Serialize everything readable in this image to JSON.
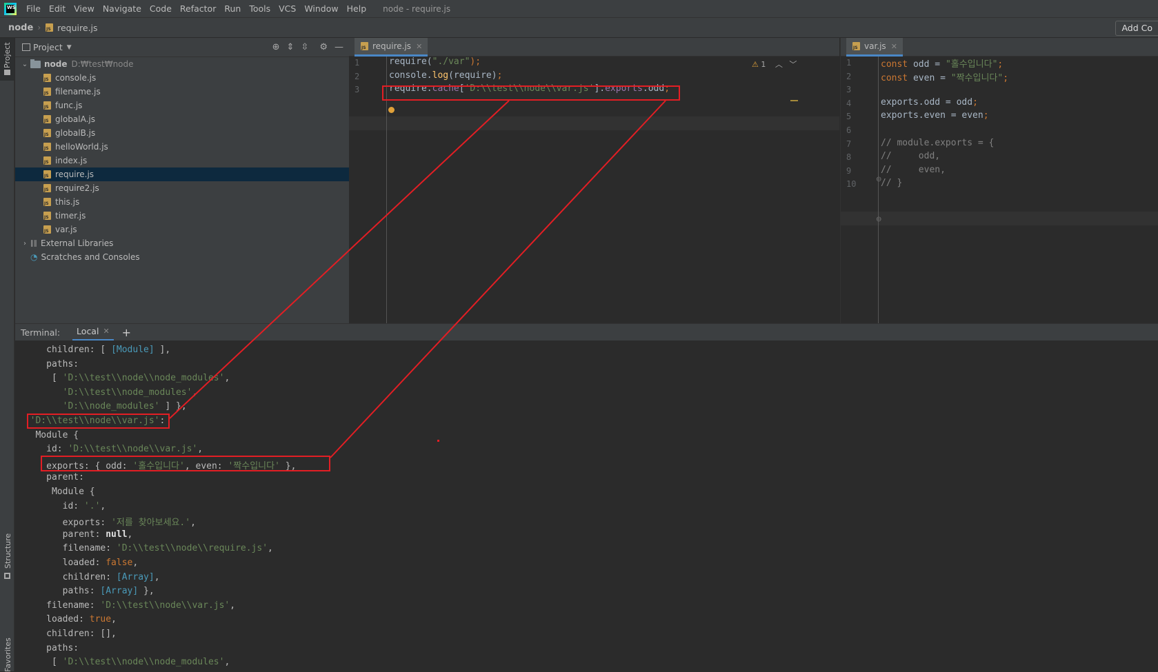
{
  "app": {
    "logo_text": "WS",
    "window_title": "node - require.js"
  },
  "menu": [
    "File",
    "Edit",
    "View",
    "Navigate",
    "Code",
    "Refactor",
    "Run",
    "Tools",
    "VCS",
    "Window",
    "Help"
  ],
  "nav": {
    "project": "node",
    "file": "require.js",
    "add_config": "Add Co"
  },
  "side_tabs": {
    "project": "Project",
    "structure": "Structure",
    "favorites": "Favorites"
  },
  "project_panel": {
    "title": "Project",
    "root": {
      "name": "node",
      "path": "D:₩test₩node"
    },
    "files": [
      "console.js",
      "filename.js",
      "func.js",
      "globalA.js",
      "globalB.js",
      "helloWorld.js",
      "index.js",
      "require.js",
      "require2.js",
      "this.js",
      "timer.js",
      "var.js"
    ],
    "selected": "require.js",
    "external": "External Libraries",
    "scratches": "Scratches and Consoles"
  },
  "editor_left": {
    "tab": "require.js",
    "line_numbers": [
      "1",
      "2",
      "3"
    ],
    "warning_count": "1",
    "lines": [
      [
        {
          "t": "require(",
          "c": ""
        },
        {
          "t": "\"./var\"",
          "c": "str"
        },
        {
          "t": ");",
          "c": "kw"
        }
      ],
      [
        {
          "t": "console.",
          "c": ""
        },
        {
          "t": "log",
          "c": "fn"
        },
        {
          "t": "(require)",
          "c": ""
        },
        {
          "t": ";",
          "c": "kw"
        }
      ],
      [
        {
          "t": "require.",
          "c": ""
        },
        {
          "t": "cache",
          "c": "prop"
        },
        {
          "t": "[",
          "c": ""
        },
        {
          "t": "'D:\\\\test\\\\node\\\\var.js'",
          "c": "str"
        },
        {
          "t": "].",
          "c": ""
        },
        {
          "t": "exports",
          "c": "prop"
        },
        {
          "t": ".odd",
          "c": ""
        },
        {
          "t": ";",
          "c": "kw"
        }
      ]
    ]
  },
  "editor_right": {
    "tab": "var.js",
    "line_numbers": [
      "1",
      "2",
      "3",
      "4",
      "5",
      "6",
      "7",
      "8",
      "9",
      "10"
    ],
    "lines": [
      [
        {
          "t": "const ",
          "c": "kw"
        },
        {
          "t": "odd = ",
          "c": ""
        },
        {
          "t": "\"홀수입니다\"",
          "c": "str"
        },
        {
          "t": ";",
          "c": "kw"
        }
      ],
      [
        {
          "t": "const ",
          "c": "kw"
        },
        {
          "t": "even = ",
          "c": ""
        },
        {
          "t": "\"짝수입니다\"",
          "c": "str"
        },
        {
          "t": ";",
          "c": "kw"
        }
      ],
      [],
      [
        {
          "t": "exports.odd = odd",
          "c": ""
        },
        {
          "t": ";",
          "c": "kw"
        }
      ],
      [
        {
          "t": "exports.even = even",
          "c": ""
        },
        {
          "t": ";",
          "c": "kw"
        }
      ],
      [],
      [
        {
          "t": "// module.exports = {",
          "c": "cmt"
        }
      ],
      [
        {
          "t": "//     odd,",
          "c": "cmt"
        }
      ],
      [
        {
          "t": "//     even,",
          "c": "cmt"
        }
      ],
      [
        {
          "t": "// }",
          "c": "cmt"
        }
      ]
    ]
  },
  "terminal": {
    "label": "Terminal:",
    "tab": "Local",
    "add": "+",
    "lines": [
      [
        {
          "t": "     children: [ ",
          "c": ""
        },
        {
          "t": "[Module]",
          "c": "tb"
        },
        {
          "t": " ],",
          "c": ""
        }
      ],
      [
        {
          "t": "     paths:",
          "c": ""
        }
      ],
      [
        {
          "t": "      [ ",
          "c": ""
        },
        {
          "t": "'D:\\\\test\\\\node\\\\node_modules'",
          "c": "tg"
        },
        {
          "t": ",",
          "c": ""
        }
      ],
      [
        {
          "t": "        ",
          "c": ""
        },
        {
          "t": "'D:\\\\test\\\\node_modules'",
          "c": "tg"
        },
        {
          "t": ",",
          "c": ""
        }
      ],
      [
        {
          "t": "        ",
          "c": ""
        },
        {
          "t": "'D:\\\\node_modules'",
          "c": "tg"
        },
        {
          "t": " ] },",
          "c": ""
        }
      ],
      [
        {
          "t": "  ",
          "c": ""
        },
        {
          "t": "'D:\\\\test\\\\node\\\\var.js'",
          "c": "tg"
        },
        {
          "t": ":",
          "c": ""
        }
      ],
      [
        {
          "t": "   Module {",
          "c": ""
        }
      ],
      [
        {
          "t": "     id: ",
          "c": ""
        },
        {
          "t": "'D:\\\\test\\\\node\\\\var.js'",
          "c": "tg"
        },
        {
          "t": ",",
          "c": ""
        }
      ],
      [
        {
          "t": "     exports: { odd: ",
          "c": ""
        },
        {
          "t": "'홀수입니다'",
          "c": "tg"
        },
        {
          "t": ", even: ",
          "c": ""
        },
        {
          "t": "'짝수입니다'",
          "c": "tg"
        },
        {
          "t": " },",
          "c": ""
        }
      ],
      [
        {
          "t": "     parent:",
          "c": ""
        }
      ],
      [
        {
          "t": "      Module {",
          "c": ""
        }
      ],
      [
        {
          "t": "        id: ",
          "c": ""
        },
        {
          "t": "'.'",
          "c": "tg"
        },
        {
          "t": ",",
          "c": ""
        }
      ],
      [
        {
          "t": "        exports: ",
          "c": ""
        },
        {
          "t": "'저를 찾아보세요.'",
          "c": "tg"
        },
        {
          "t": ",",
          "c": ""
        }
      ],
      [
        {
          "t": "        parent: ",
          "c": ""
        },
        {
          "t": "null",
          "c": "tw"
        },
        {
          "t": ",",
          "c": ""
        }
      ],
      [
        {
          "t": "        filename: ",
          "c": ""
        },
        {
          "t": "'D:\\\\test\\\\node\\\\require.js'",
          "c": "tg"
        },
        {
          "t": ",",
          "c": ""
        }
      ],
      [
        {
          "t": "        loaded: ",
          "c": ""
        },
        {
          "t": "false",
          "c": "to"
        },
        {
          "t": ",",
          "c": ""
        }
      ],
      [
        {
          "t": "        children: ",
          "c": ""
        },
        {
          "t": "[Array]",
          "c": "tb"
        },
        {
          "t": ",",
          "c": ""
        }
      ],
      [
        {
          "t": "        paths: ",
          "c": ""
        },
        {
          "t": "[Array]",
          "c": "tb"
        },
        {
          "t": " },",
          "c": ""
        }
      ],
      [
        {
          "t": "     filename: ",
          "c": ""
        },
        {
          "t": "'D:\\\\test\\\\node\\\\var.js'",
          "c": "tg"
        },
        {
          "t": ",",
          "c": ""
        }
      ],
      [
        {
          "t": "     loaded: ",
          "c": ""
        },
        {
          "t": "true",
          "c": "to"
        },
        {
          "t": ",",
          "c": ""
        }
      ],
      [
        {
          "t": "     children: [],",
          "c": ""
        }
      ],
      [
        {
          "t": "     paths:",
          "c": ""
        }
      ],
      [
        {
          "t": "      [ ",
          "c": ""
        },
        {
          "t": "'D:\\\\test\\\\node\\\\node_modules'",
          "c": "tg"
        },
        {
          "t": ",",
          "c": ""
        }
      ]
    ]
  },
  "colors": {
    "annotation": "#e31e24",
    "selection": "#0d293e",
    "accent": "#4a88c7"
  }
}
